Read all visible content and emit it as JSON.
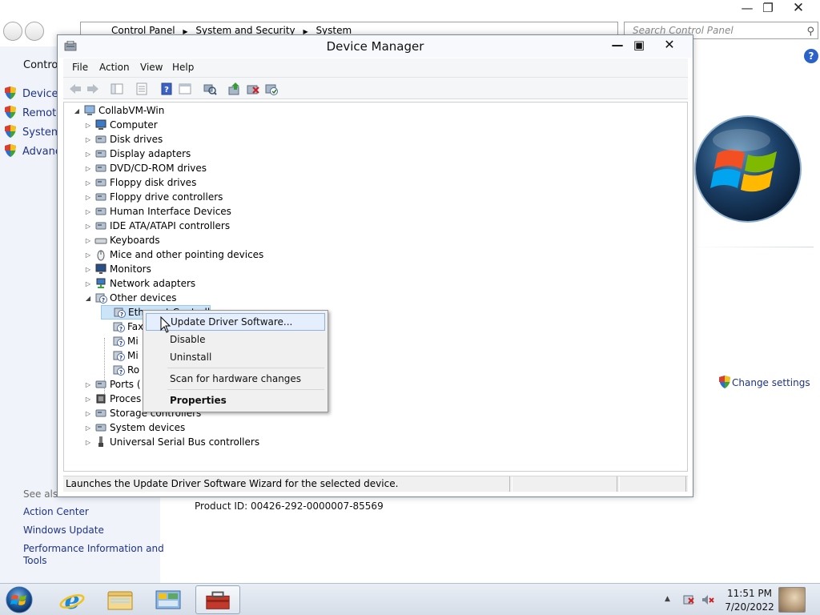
{
  "control_panel": {
    "breadcrumb": [
      "Control Panel",
      "System and Security",
      "System"
    ],
    "search_placeholder": "Search Control Panel",
    "left_header": "Control",
    "tasks": [
      "Device M",
      "Remote",
      "System",
      "Advanc"
    ],
    "see_also_label": "See also",
    "see_also_links": [
      "Action Center",
      "Windows Update",
      "Performance Information and",
      "Tools"
    ],
    "change_settings": "Change settings",
    "product_id": "Product ID: 00426-292-0000007-85569",
    "help": "?"
  },
  "device_manager": {
    "title": "Device Manager",
    "menus": [
      "File",
      "Action",
      "View",
      "Help"
    ],
    "root": "CollabVM-Win",
    "categories": [
      {
        "label": "Computer",
        "icon": "computer-icon"
      },
      {
        "label": "Disk drives",
        "icon": "disk-drive-icon"
      },
      {
        "label": "Display adapters",
        "icon": "display-adapter-icon"
      },
      {
        "label": "DVD/CD-ROM drives",
        "icon": "dvd-drive-icon"
      },
      {
        "label": "Floppy disk drives",
        "icon": "floppy-disk-icon"
      },
      {
        "label": "Floppy drive controllers",
        "icon": "floppy-controller-icon"
      },
      {
        "label": "Human Interface Devices",
        "icon": "hid-icon"
      },
      {
        "label": "IDE ATA/ATAPI controllers",
        "icon": "ide-controller-icon"
      },
      {
        "label": "Keyboards",
        "icon": "keyboard-icon"
      },
      {
        "label": "Mice and other pointing devices",
        "icon": "mouse-icon"
      },
      {
        "label": "Monitors",
        "icon": "monitor-icon"
      },
      {
        "label": "Network adapters",
        "icon": "network-adapter-icon"
      },
      {
        "label": "Other devices",
        "icon": "unknown-device-icon"
      }
    ],
    "other_devices": [
      "Ethernet Controll",
      "Fax",
      "Mi",
      "Mi",
      "Ro"
    ],
    "categories_after": [
      {
        "label": "Ports (",
        "icon": "port-icon"
      },
      {
        "label": "Proces",
        "icon": "processor-icon"
      },
      {
        "label": "Storage controllers",
        "icon": "storage-controller-icon"
      },
      {
        "label": "System devices",
        "icon": "system-device-icon"
      },
      {
        "label": "Universal Serial Bus controllers",
        "icon": "usb-icon"
      }
    ],
    "status_text": "Launches the Update Driver Software Wizard for the selected device."
  },
  "context_menu": {
    "items": [
      "Update Driver Software...",
      "Disable",
      "Uninstall",
      "Scan for hardware changes",
      "Properties"
    ]
  },
  "taskbar": {
    "time": "11:51 PM",
    "date": "7/20/2022"
  },
  "colors": {
    "link_blue": "#1e3287",
    "highlight": "#e4eefc",
    "taskbar": "#d5dde8"
  }
}
